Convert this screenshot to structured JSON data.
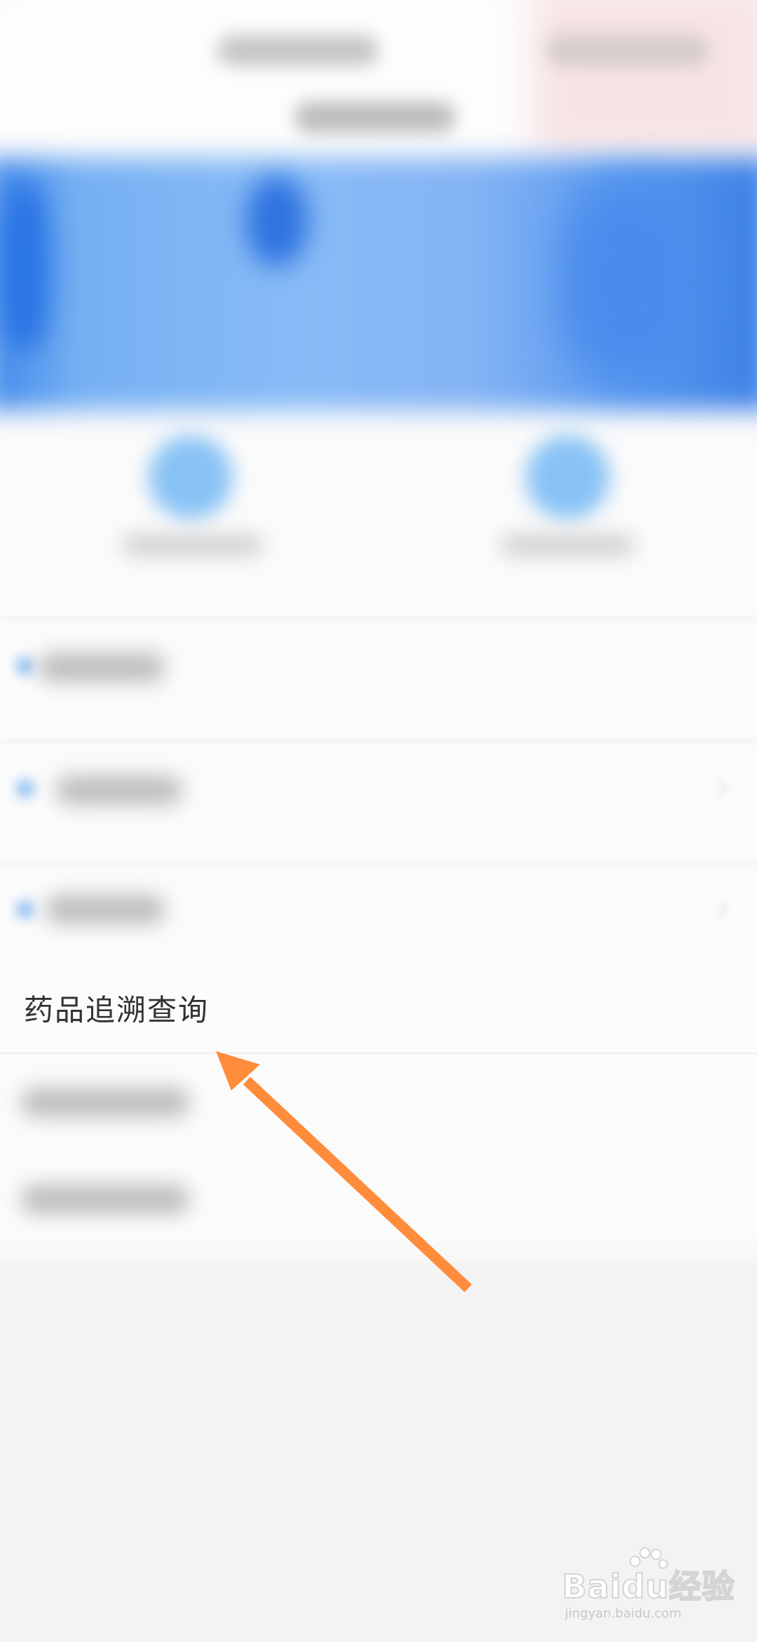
{
  "menu": {
    "highlighted_item": {
      "label": "药品追溯查询"
    }
  },
  "annotation": {
    "arrow_color": "#ff8c3a",
    "arrow_target": "药品追溯查询"
  },
  "watermark": {
    "brand": "Baidu经验",
    "url": "jingyan.baidu.com"
  },
  "colors": {
    "banner_blue": "#3f88ea",
    "icon_blue": "#88c2f5",
    "background": "#f3f3f3",
    "row_text": "#333333"
  }
}
